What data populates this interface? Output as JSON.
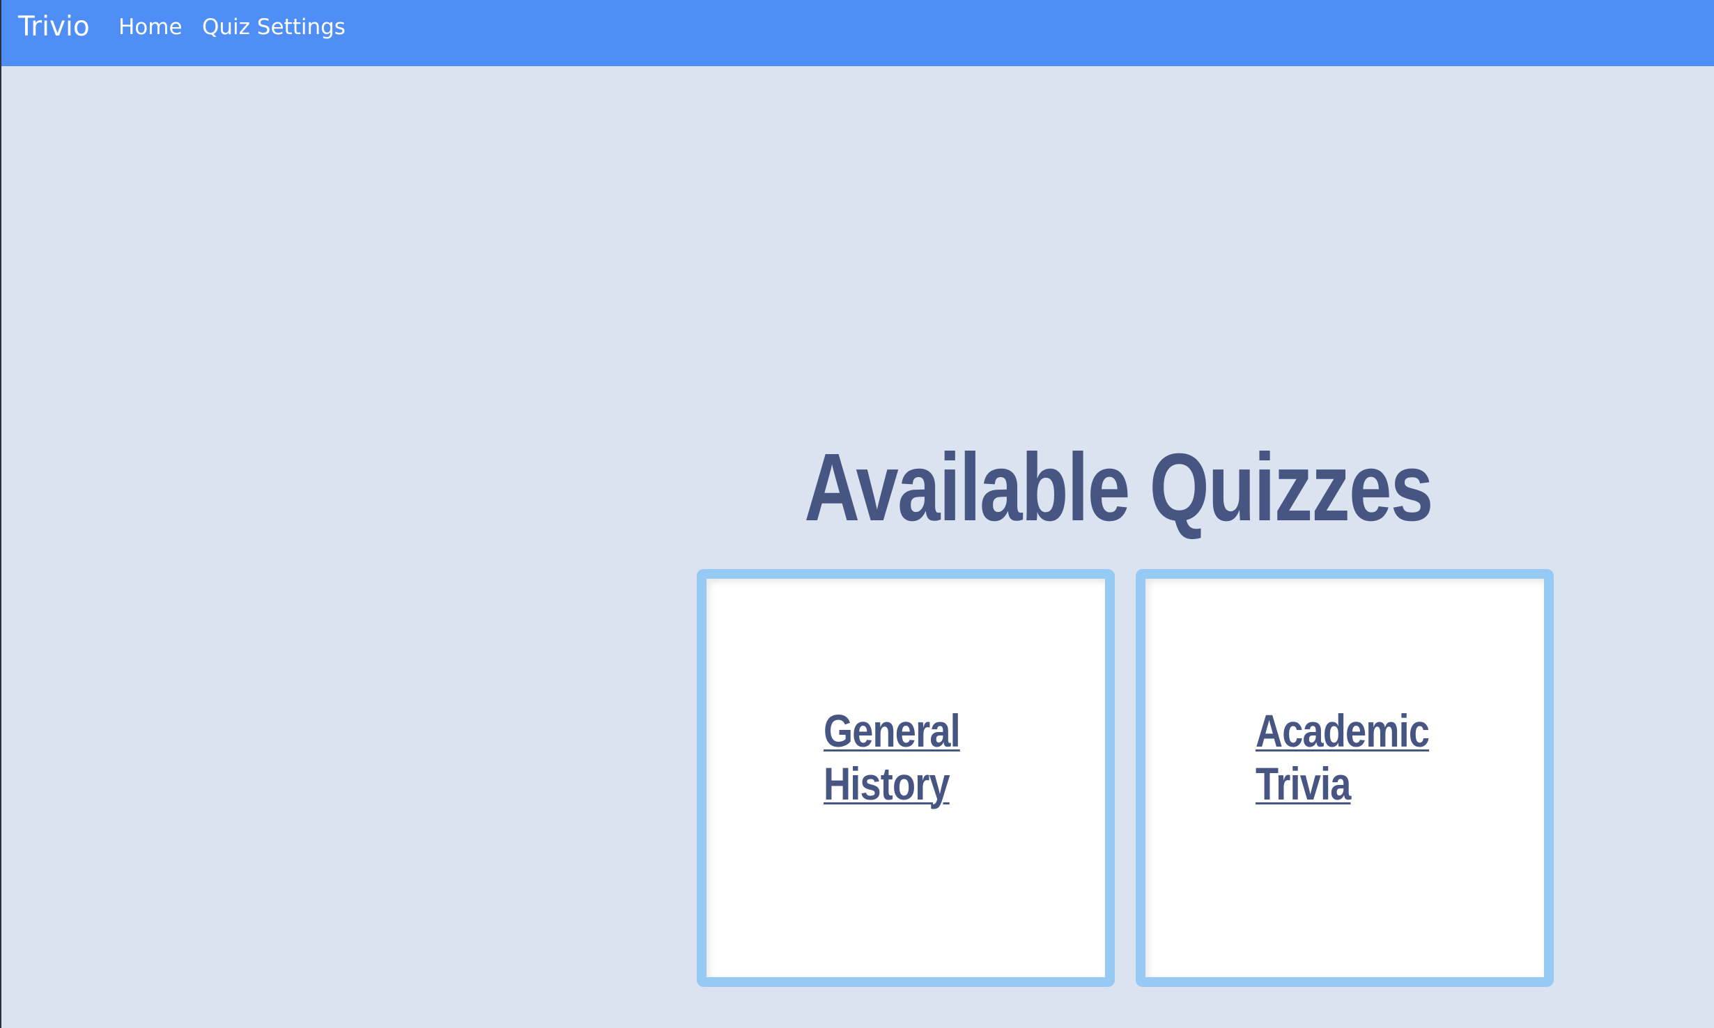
{
  "navbar": {
    "brand": "Trivio",
    "links": [
      "Home",
      "Quiz Settings"
    ],
    "background_color": "#4f8ef5"
  },
  "main": {
    "title": "Available Quizzes",
    "title_color": "#475582",
    "background_color": "#dbe3f0",
    "quizzes": [
      {
        "line1": "General",
        "line2": "History"
      },
      {
        "line1": "Academic",
        "line2": "Trivia"
      }
    ],
    "card_border_color": "#97c9f5"
  }
}
